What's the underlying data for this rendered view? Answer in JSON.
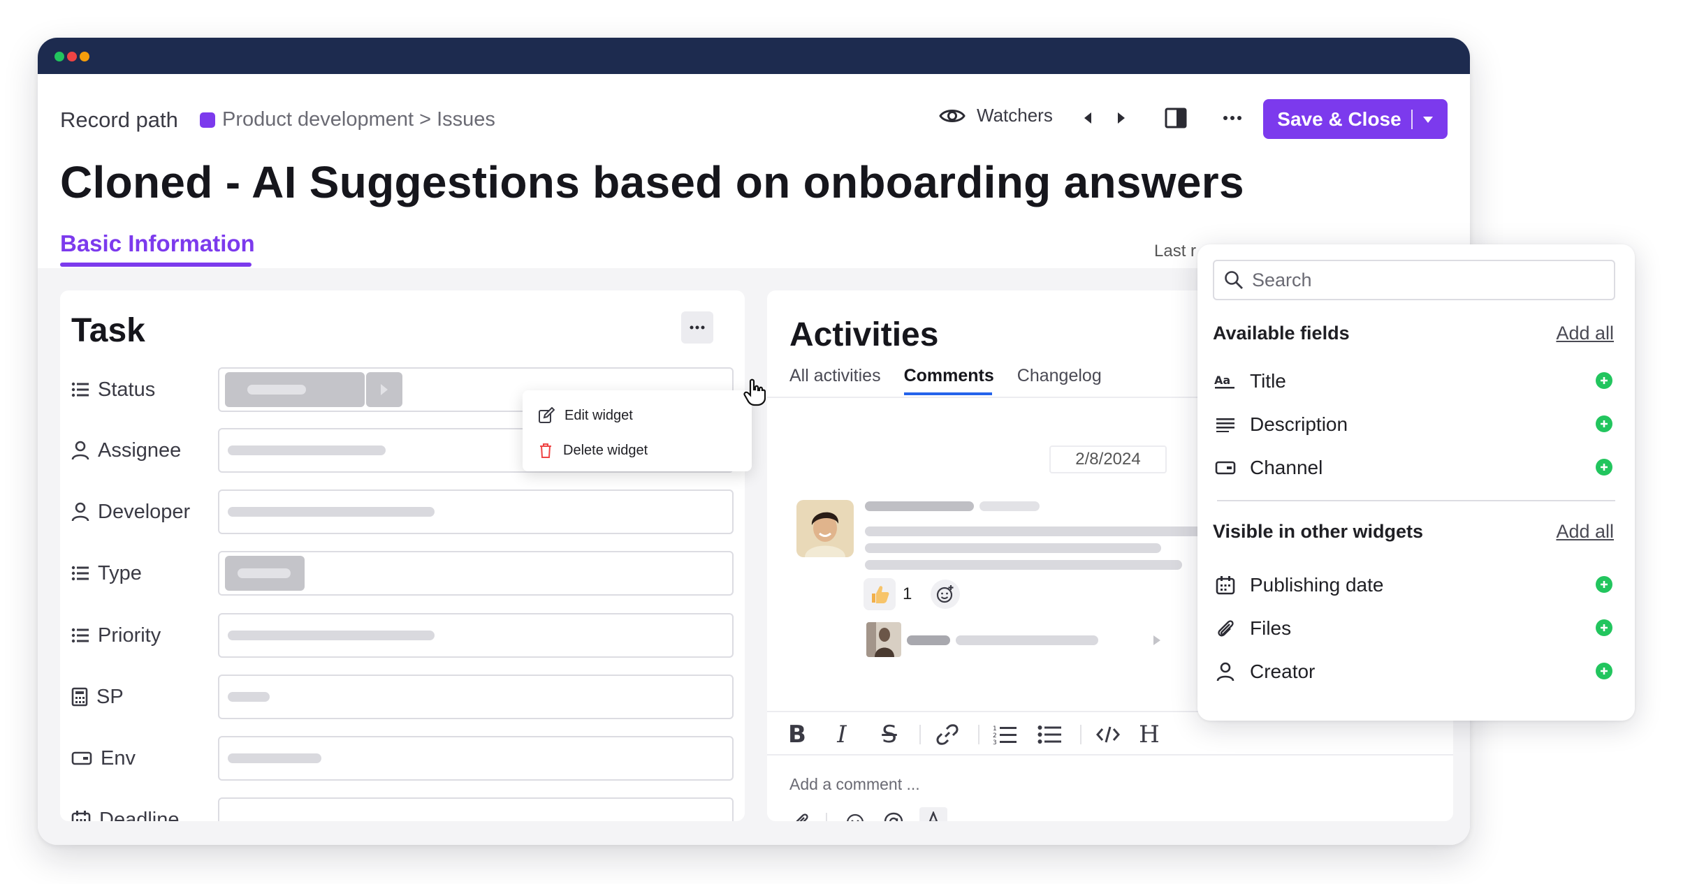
{
  "header": {
    "record_path_label": "Record path",
    "breadcrumb": "Product development > Issues",
    "watchers_label": "Watchers",
    "save_label": "Save & Close"
  },
  "page": {
    "title": "Cloned - AI Suggestions based on onboarding answers",
    "tab_basic": "Basic Information",
    "last_modified_partial": "Last r"
  },
  "task_widget": {
    "title": "Task",
    "fields": [
      {
        "label": "Status",
        "icon": "list-icon"
      },
      {
        "label": "Assignee",
        "icon": "user-icon"
      },
      {
        "label": "Developer",
        "icon": "user-icon"
      },
      {
        "label": "Type",
        "icon": "list-icon"
      },
      {
        "label": "Priority",
        "icon": "list-icon"
      },
      {
        "label": "SP",
        "icon": "calculator-icon"
      },
      {
        "label": "Env",
        "icon": "tag-icon"
      },
      {
        "label": "Deadline",
        "icon": "calendar-icon"
      }
    ],
    "menu": {
      "edit": "Edit widget",
      "delete": "Delete widget"
    }
  },
  "activities": {
    "title": "Activities",
    "tabs": [
      "All activities",
      "Comments",
      "Changelog"
    ],
    "active_tab": "Comments",
    "date": "2/8/2024",
    "reaction_count": "1",
    "comment_placeholder": "Add a comment ..."
  },
  "fields_panel": {
    "search_placeholder": "Search",
    "available_heading": "Available fields",
    "available_add_all": "Add all",
    "available": [
      {
        "label": "Title",
        "icon": "text-format-icon"
      },
      {
        "label": "Description",
        "icon": "paragraph-icon"
      },
      {
        "label": "Channel",
        "icon": "tag-icon"
      }
    ],
    "visible_heading": "Visible in other widgets",
    "visible_add_all": "Add all",
    "visible": [
      {
        "label": "Publishing date",
        "icon": "calendar-icon"
      },
      {
        "label": "Files",
        "icon": "paperclip-icon"
      },
      {
        "label": "Creator",
        "icon": "user-icon"
      }
    ]
  },
  "colors": {
    "accent": "#7c3aed",
    "titlebar": "#1d2b4f",
    "add_green": "#22c55e",
    "tab_blue": "#2563eb"
  }
}
